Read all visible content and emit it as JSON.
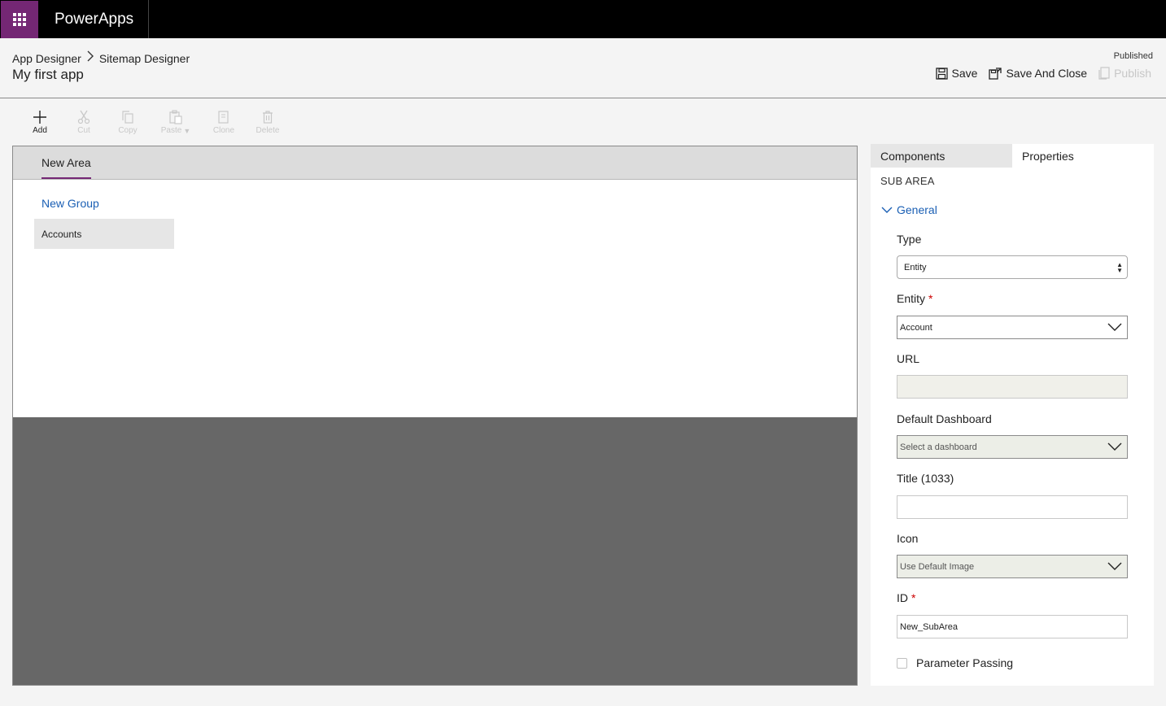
{
  "topbar": {
    "app_name": "PowerApps"
  },
  "breadcrumb": {
    "root": "App Designer",
    "current": "Sitemap Designer"
  },
  "page_title": "My first app",
  "status": "Published",
  "actions": {
    "save": "Save",
    "save_close": "Save And Close",
    "publish": "Publish"
  },
  "toolbar": {
    "add": "Add",
    "cut": "Cut",
    "copy": "Copy",
    "paste": "Paste",
    "clone": "Clone",
    "delete": "Delete"
  },
  "canvas": {
    "area": "New Area",
    "group": "New Group",
    "subarea": "Accounts"
  },
  "panel": {
    "tabs": {
      "components": "Components",
      "properties": "Properties"
    },
    "heading": "SUB AREA",
    "section": "General",
    "fields": {
      "type_label": "Type",
      "type_value": "Entity",
      "entity_label": "Entity",
      "entity_value": "Account",
      "url_label": "URL",
      "url_value": "",
      "dashboard_label": "Default Dashboard",
      "dashboard_value": "Select a dashboard",
      "title_label": "Title (1033)",
      "title_value": "",
      "icon_label": "Icon",
      "icon_value": "Use Default Image",
      "id_label": "ID",
      "id_value": "New_SubArea",
      "param_label": "Parameter Passing"
    },
    "required_marker": "*"
  },
  "colors": {
    "brand": "#742774",
    "link": "#1a5fb4",
    "required": "#cc0000"
  },
  "icons": [
    "waffle-icon",
    "chevron-right-icon",
    "save-icon",
    "save-close-icon",
    "publish-icon",
    "add-icon",
    "cut-icon",
    "copy-icon",
    "paste-icon",
    "clone-icon",
    "delete-icon",
    "chevron-down-icon"
  ]
}
